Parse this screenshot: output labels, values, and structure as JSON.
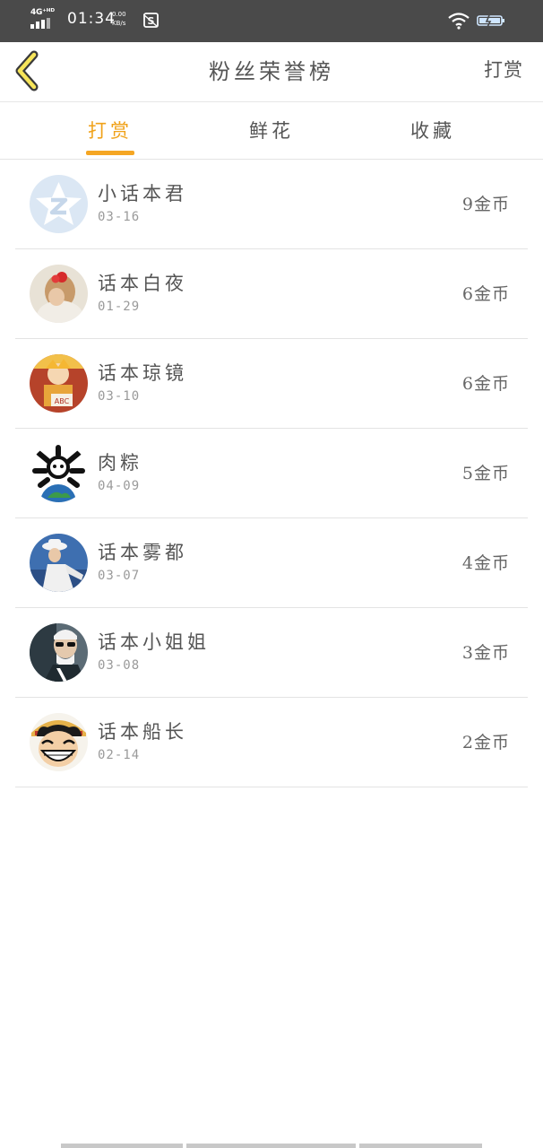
{
  "status_bar": {
    "network": "4G⁺ᴴᴰ",
    "time": "01:34",
    "speed_value": "0.00",
    "speed_unit": "KB/s"
  },
  "header": {
    "title": "粉丝荣誉榜",
    "action_label": "打赏"
  },
  "tabs": [
    {
      "label": "打赏",
      "active": true
    },
    {
      "label": "鲜花",
      "active": false
    },
    {
      "label": "收藏",
      "active": false
    }
  ],
  "colors": {
    "accent": "#f5a623",
    "status_bar": "#4a4a4a",
    "text": "#555555",
    "subtext": "#9a9a9a"
  },
  "fans": [
    {
      "name": "小话本君",
      "date": "03-16",
      "coins": "9金币",
      "avatar": "qq-default-avatar"
    },
    {
      "name": "话本白夜",
      "date": "01-29",
      "coins": "6金币",
      "avatar": "girl-red-bow-avatar"
    },
    {
      "name": "话本琼镜",
      "date": "03-10",
      "coins": "6金币",
      "avatar": "anime-character-avatar"
    },
    {
      "name": "肉粽",
      "date": "04-09",
      "coins": "5金币",
      "avatar": "earth-skull-avatar"
    },
    {
      "name": "话本雾都",
      "date": "03-07",
      "coins": "4金币",
      "avatar": "white-hat-figure-avatar"
    },
    {
      "name": "话本小姐姐",
      "date": "03-08",
      "coins": "3金币",
      "avatar": "sunglasses-man-avatar"
    },
    {
      "name": "话本船长",
      "date": "02-14",
      "coins": "2金币",
      "avatar": "luffy-smile-avatar"
    }
  ]
}
